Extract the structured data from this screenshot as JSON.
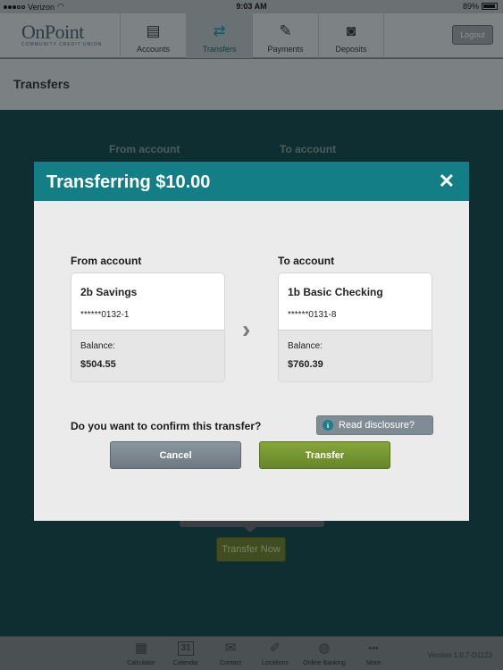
{
  "status": {
    "carrier": "Verizon",
    "time": "9:03 AM",
    "battery": "89%"
  },
  "header": {
    "logo_name": "OnPoint",
    "logo_sub": "COMMUNITY CREDIT UNION",
    "nav": [
      {
        "label": "Accounts",
        "icon": "wallet-icon",
        "glyph": "▤"
      },
      {
        "label": "Transfers",
        "icon": "transfer-arrows-icon",
        "glyph": "⇄"
      },
      {
        "label": "Payments",
        "icon": "check-pen-icon",
        "glyph": "✎"
      },
      {
        "label": "Deposits",
        "icon": "camera-icon",
        "glyph": "◙"
      }
    ],
    "active_nav": "Transfers",
    "logout_label": "Logout"
  },
  "page": {
    "title": "Transfers"
  },
  "background": {
    "from_label": "From account",
    "to_label": "To account",
    "transfer_now_label": "Transfer Now"
  },
  "dialog": {
    "title": "Transferring $10.00",
    "close_glyph": "✕",
    "from": {
      "label": "From account",
      "name": "2b Savings",
      "number": "******0132-1",
      "balance_label": "Balance:",
      "balance": "$504.55"
    },
    "to": {
      "label": "To account",
      "name": "1b Basic Checking",
      "number": "******0131-8",
      "balance_label": "Balance:",
      "balance": "$760.39"
    },
    "arrow_glyph": "›",
    "question": "Do you want to confirm this transfer?",
    "disclosure_label": "Read disclosure?",
    "cancel_label": "Cancel",
    "transfer_label": "Transfer"
  },
  "toolbar": {
    "items": [
      {
        "label": "Calculator",
        "icon": "calculator-icon",
        "glyph": "▦"
      },
      {
        "label": "Calendar",
        "icon": "calendar-icon",
        "glyph": "31"
      },
      {
        "label": "Contact",
        "icon": "envelope-icon",
        "glyph": "✉"
      },
      {
        "label": "Locations",
        "icon": "pin-icon",
        "glyph": "✐"
      },
      {
        "label": "Online Banking",
        "icon": "globe-icon",
        "glyph": "◍"
      },
      {
        "label": "More",
        "icon": "more-icon",
        "glyph": "•••"
      }
    ],
    "version": "Version 1.0.7-D1123"
  }
}
